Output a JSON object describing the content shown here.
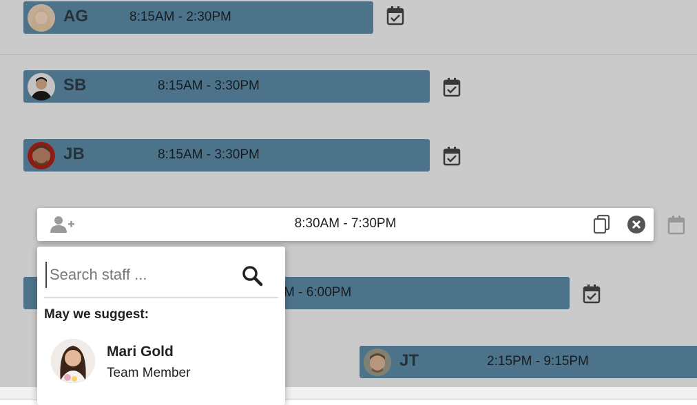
{
  "shifts": [
    {
      "initials": "AG",
      "time": "8:15AM - 2:30PM"
    },
    {
      "initials": "SB",
      "time": "8:15AM - 3:30PM"
    },
    {
      "initials": "JB",
      "time": "8:15AM - 3:30PM"
    },
    {
      "initials": "",
      "time": "M - 6:00PM"
    },
    {
      "initials": "JT",
      "time": "2:15PM - 9:15PM"
    }
  ],
  "editor": {
    "time": "8:30AM - 7:30PM"
  },
  "staff_search": {
    "placeholder": "Search staff ...",
    "suggest_heading": "May we suggest:",
    "suggestion": {
      "name": "Mari Gold",
      "role": "Team Member"
    }
  },
  "icons": {
    "calendar": "calendar-check-icon",
    "add_user": "user-plus-icon",
    "copy": "copy-icon",
    "close": "close-circle-icon",
    "search": "search-icon"
  },
  "colors": {
    "shift_bar": "#5c8aa6",
    "background": "#f1f1f1"
  }
}
